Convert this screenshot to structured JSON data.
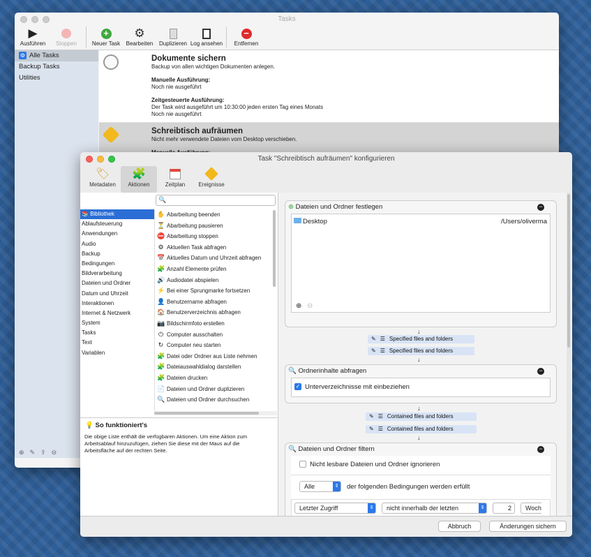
{
  "main": {
    "title": "Tasks",
    "toolbar": [
      {
        "label": "Ausführen",
        "icon": "play-icon",
        "disabled": false
      },
      {
        "label": "Stoppen",
        "icon": "stop-icon",
        "disabled": true
      },
      {
        "label": "Neuer Task",
        "icon": "plus-icon",
        "disabled": false
      },
      {
        "label": "Bearbeiten",
        "icon": "gear-icon",
        "disabled": false
      },
      {
        "label": "Duplizieren",
        "icon": "duplicate-icon",
        "disabled": false
      },
      {
        "label": "Log ansehen",
        "icon": "clipboard-icon",
        "disabled": false
      },
      {
        "label": "Entfernen",
        "icon": "remove-icon",
        "disabled": false
      }
    ],
    "sidebar": {
      "items": [
        "Alle Tasks",
        "Backup Tasks",
        "Utilities"
      ]
    },
    "tasks": [
      {
        "title": "Dokumente sichern",
        "desc": "Backup von allen wichtigen Dokumenten anlegen.",
        "manual_label": "Manuelle Ausführung:",
        "manual_value": "Noch nie ausgeführt",
        "sched_label": "Zeitgesteuerte Ausführung:",
        "sched_value1": "Der Task wird ausgeführt um 10:30:00 jeden ersten Tag eines Monats",
        "sched_value2": "Noch nie ausgeführt"
      },
      {
        "title": "Schreibtisch aufräumen",
        "desc": "Nicht mehr verwendete Dateien vom Desktop verschieben.",
        "manual_label": "Manuelle Ausführung:"
      }
    ]
  },
  "config": {
    "title": "Task \"Schreibtisch aufräumen\" konfigurieren",
    "tabs": [
      "Metadaten",
      "Aktionen",
      "Zeitplan",
      "Ereignisse"
    ],
    "categories": [
      "Bibliothek",
      "Ablaufsteuerung",
      "Anwendungen",
      "Audio",
      "Backup",
      "Bedingungen",
      "Bildverarbeitung",
      "Dateien und Ordner",
      "Datum und Uhrzeit",
      "Interaktionen",
      "Internet & Netzwerk",
      "System",
      "Tasks",
      "Text",
      "Variablen"
    ],
    "actions": [
      "Abarbeitung beenden",
      "Abarbeitung pausieren",
      "Abarbeitung stoppen",
      "Aktuellen Task abfragen",
      "Aktuelles Datum und Uhrzeit abfragen",
      "Anzahl Elemente prüfen",
      "Audiodatei abspielen",
      "Bei einer Sprungmarke fortsetzen",
      "Benutzername abfragen",
      "Benutzerverzeichnis abfragen",
      "Bildschirmfoto erstellen",
      "Computer ausschalten",
      "Computer neu starten",
      "Datei oder Ordner aus Liste nehmen",
      "Dateiauswahldialog darstellen",
      "Dateien drucken",
      "Dateien und Ordner duplizieren",
      "Dateien und Ordner durchsuchen"
    ],
    "action_icons": [
      "✋",
      "⏳",
      "⛔",
      "⚙",
      "📅",
      "🧩",
      "🔊",
      "⚡",
      "👤",
      "🏠",
      "📷",
      "⏻",
      "↻",
      "🧩",
      "🧩",
      "🧩",
      "📄",
      "🔍"
    ],
    "howto_title": "So funktioniert's",
    "howto_text": "Die obige Liste enthält die verfügbaren Aktionen. Um eine Aktion zum Arbeitsablauf hinzuzufügen, ziehen Sie diese mit der Maus auf die Arbeitsfläche auf der rechten Seite.",
    "box1": {
      "title": "Dateien und Ordner festlegen",
      "item_name": "Desktop",
      "item_path": "/Users/oliverma"
    },
    "var1": "Specified files and folders",
    "var2": "Specified files and folders",
    "box2": {
      "title": "Ordnerinhalte abfragen",
      "option": "Unterverzeichnisse mit einbeziehen"
    },
    "var3": "Contained files and folders",
    "var4": "Contained files and folders",
    "box3": {
      "title": "Dateien und Ordner filtern",
      "option": "Nicht lesbare Dateien und Ordner ignorieren",
      "match_select": "Alle",
      "match_text": "der folgenden Bedingungen werden erfüllt",
      "cond_field": "Letzter Zugriff",
      "cond_op": "nicht innerhalb der letzten",
      "cond_value": "2",
      "cond_unit": "Woch"
    },
    "cancel": "Abbruch",
    "save": "Änderungen sichern"
  }
}
